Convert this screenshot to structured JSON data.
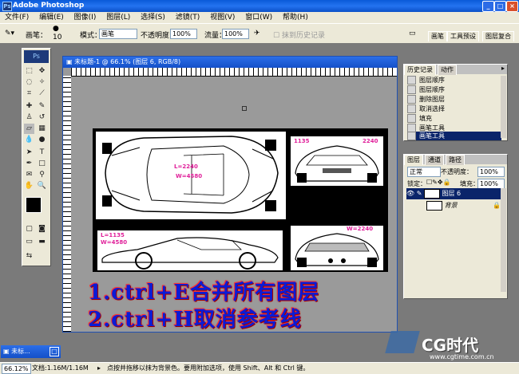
{
  "app": {
    "title": "Adobe Photoshop"
  },
  "menu": [
    "文件(F)",
    "编辑(E)",
    "图像(I)",
    "图层(L)",
    "选择(S)",
    "滤镜(T)",
    "视图(V)",
    "窗口(W)",
    "帮助(H)"
  ],
  "options": {
    "brush_label": "画笔：",
    "brush_size": "10",
    "mode_label": "模式：",
    "mode_value": "画笔",
    "opacity_label": "不透明度：",
    "opacity_value": "100%",
    "flow_label": "流量：",
    "flow_value": "100%",
    "erase_history": "抹到历史记录",
    "palette_tabs": [
      "画笔",
      "工具预设",
      "图层复合"
    ]
  },
  "document": {
    "title": "未标题-1 @ 66.1% (图层 6, RGB/8)",
    "labels": {
      "top_l": "L=2240",
      "top_w": "W=4580",
      "front_l": "1135",
      "front_w": "2240",
      "side_l": "L=1135",
      "side_w": "W=4580",
      "rear_w": "W=2240"
    }
  },
  "overlay_text": [
    "1.ctrl+E合并所有图层",
    "2.ctrl+H取消参考线"
  ],
  "history": {
    "tabs": [
      "历史记录",
      "动作"
    ],
    "items": [
      "图层顺序",
      "图层顺序",
      "删除图层",
      "取消选择",
      "填充",
      "画笔工具",
      "画笔工具"
    ]
  },
  "layers": {
    "tabs": [
      "图层",
      "通道",
      "路径"
    ],
    "blend_mode": "正常",
    "opacity_label": "不透明度：",
    "opacity_value": "100%",
    "lock_label": "锁定：",
    "fill_label": "填充：",
    "fill_value": "100%",
    "items": [
      {
        "name": "图层 6",
        "selected": true
      },
      {
        "name": "背景",
        "selected": false
      }
    ]
  },
  "status": {
    "zoom": "66.12%",
    "doc_size": "文档:1.16M/1.16M",
    "hint": "点按并拖移以抹为背景色。要用附加选项，使用 Shift、Alt 和 Ctrl 键。"
  },
  "minimized": {
    "label": "未标..."
  },
  "watermark": {
    "logo": "CG时代",
    "url": "www.cgtime.com.cn"
  },
  "colors": {
    "accent": "#0a5ad8",
    "overlay_blue": "#0b1bd6",
    "label_magenta": "#e0209a"
  }
}
